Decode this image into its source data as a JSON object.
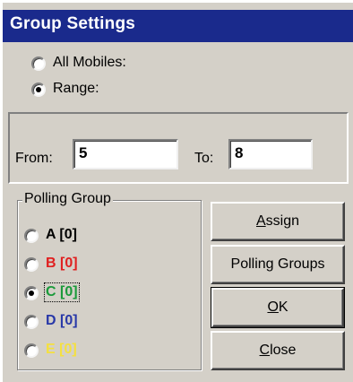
{
  "window": {
    "title": "Group Settings"
  },
  "mode": {
    "all_mobiles_label": "All Mobiles:",
    "range_label": "Range:",
    "selected": "range"
  },
  "range": {
    "from_label": "From:",
    "from_value": "5",
    "to_label": "To:",
    "to_value": "8"
  },
  "polling_group": {
    "legend": "Polling Group",
    "selected": "C",
    "items": [
      {
        "label": "A [0]",
        "color": "#000000"
      },
      {
        "label": "B [0]",
        "color": "#e02020"
      },
      {
        "label": "C [0]",
        "color": "#1a9a3a"
      },
      {
        "label": "D [0]",
        "color": "#2838a8"
      },
      {
        "label": "E [0]",
        "color": "#f4e040"
      }
    ]
  },
  "buttons": {
    "assign": {
      "mnemonic": "A",
      "rest": "ssign"
    },
    "polling_groups": "Polling Groups",
    "ok": {
      "mnemonic": "O",
      "rest": "K"
    },
    "close": {
      "mnemonic": "C",
      "rest": "lose"
    }
  }
}
